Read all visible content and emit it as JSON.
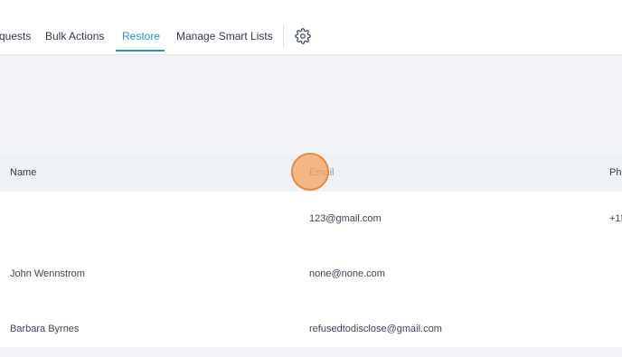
{
  "tabs": [
    {
      "label": "quests",
      "active": false
    },
    {
      "label": "Bulk Actions",
      "active": false
    },
    {
      "label": "Restore",
      "active": true
    },
    {
      "label": "Manage Smart Lists",
      "active": false
    }
  ],
  "settings_icon": "gear-icon",
  "table": {
    "columns": [
      "Name",
      "Email",
      "Ph"
    ],
    "rows": [
      {
        "name": "",
        "email": "123@gmail.com",
        "phone": "+1!"
      },
      {
        "name": "John Wennstrom",
        "email": "none@none.com",
        "phone": ""
      },
      {
        "name": "Barbara Byrnes",
        "email": "refusedtodisclose@gmail.com",
        "phone": ""
      }
    ]
  },
  "colors": {
    "accent": "#2a8fd6",
    "cursor": "#f7a05a"
  }
}
